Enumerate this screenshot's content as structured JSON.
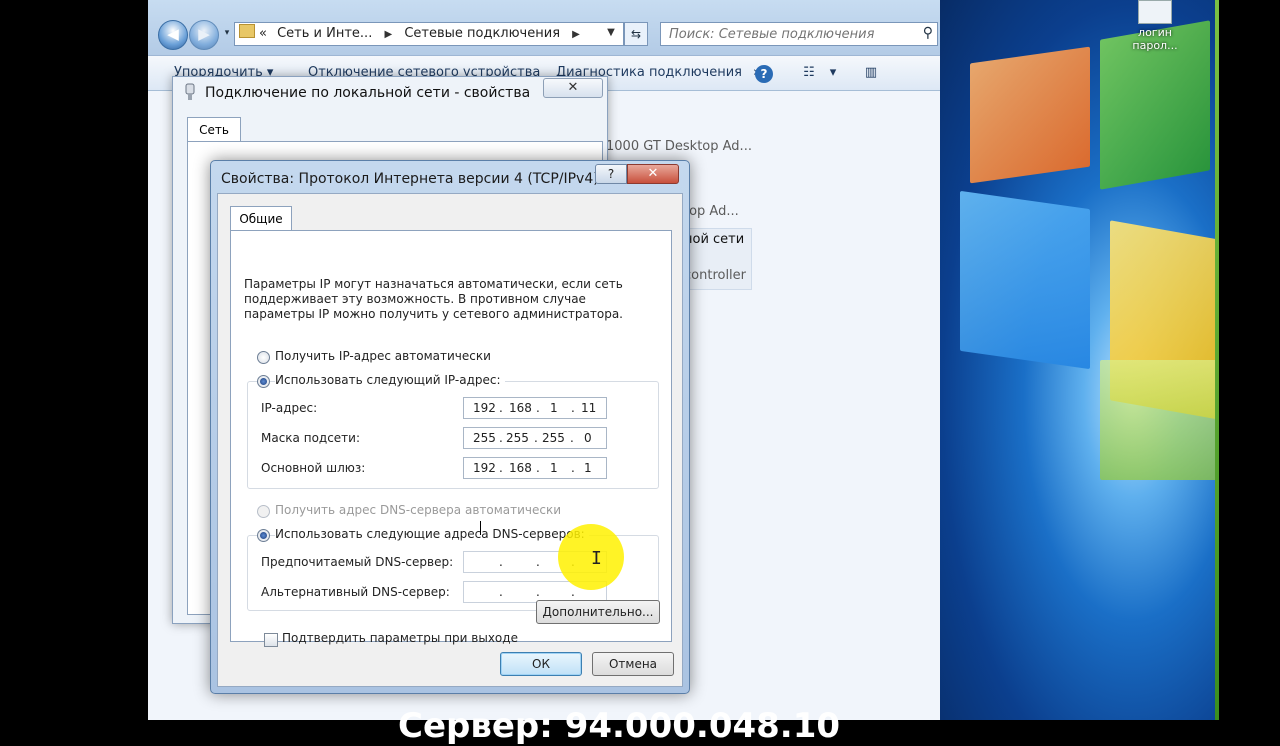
{
  "desktop": {
    "icon_label": "логин парол..."
  },
  "explorer": {
    "nav": {
      "back": "back",
      "forward": "forward"
    },
    "address": {
      "part1": "Сеть и Инте...",
      "part2": "Сетевые подключения",
      "prefix": "«"
    },
    "search_placeholder": "Поиск: Сетевые подключения",
    "toolbar": {
      "organize": "Упорядочить ▾",
      "disable": "Отключение сетевого устройства",
      "diagnose": "Диагностика подключения",
      "more": "»",
      "help": "?"
    },
    "connections": {
      "line1": "1000 GT Desktop Ad...",
      "line2": "top Ad...",
      "line3": "ной сети",
      "line4": "controller"
    }
  },
  "lan_dialog": {
    "title": "Подключение по локальной сети - свойства",
    "close": "✕",
    "tab": "Сеть"
  },
  "ipv4_dialog": {
    "title": "Свойства: Протокол Интернета версии 4 (TCP/IPv4)",
    "help": "?",
    "close": "✕",
    "tab": "Общие",
    "description": "Параметры IP могут назначаться автоматически, если сеть поддерживает эту возможность. В противном случае параметры IP можно получить у сетевого администратора.",
    "radio_ip_auto": "Получить IP-адрес автоматически",
    "radio_ip_manual": "Использовать следующий IP-адрес:",
    "ip_label": "IP-адрес:",
    "ip_octets": [
      "192",
      "168",
      "1",
      "11"
    ],
    "mask_label": "Маска подсети:",
    "mask_octets": [
      "255",
      "255",
      "255",
      "0"
    ],
    "gateway_label": "Основной шлюз:",
    "gateway_octets": [
      "192",
      "168",
      "1",
      "1"
    ],
    "radio_dns_auto": "Получить адрес DNS-сервера автоматически",
    "radio_dns_manual": "Использовать следующие адреса DNS-серверов:",
    "dns_pref_label": "Предпочитаемый DNS-сервер:",
    "dns_alt_label": "Альтернативный DNS-сервер:",
    "validate_label": "Подтвердить параметры при выходе",
    "advanced_button": "Дополнительно...",
    "ok_button": "ОК",
    "cancel_button": "Отмена"
  },
  "overlay": {
    "bottom_text": "Сервер: 94.000.048.10"
  },
  "colors": {
    "dialog_frame": "#aac3e2",
    "explorer_bg": "#f1f5fb",
    "cursor_highlight": "#fff100"
  }
}
